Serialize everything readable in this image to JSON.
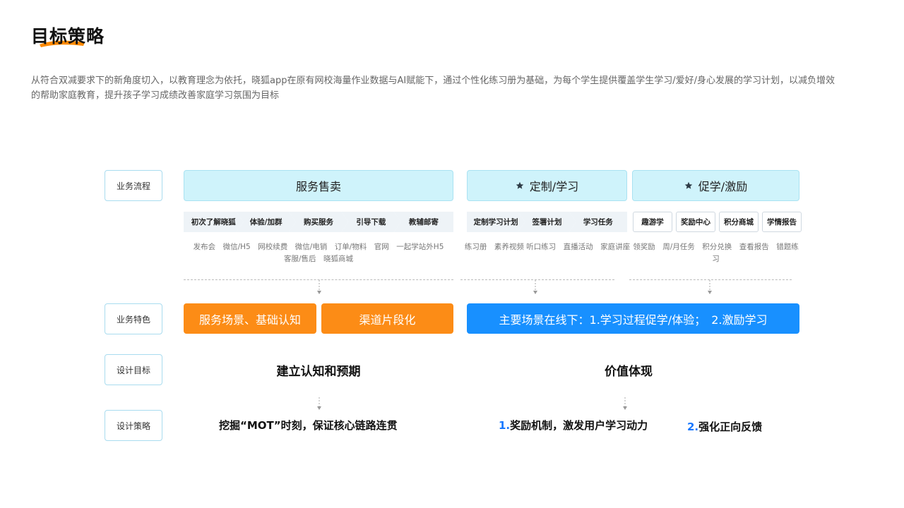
{
  "title": "目标策略",
  "intro": "从符合双减要求下的新角度切入，以教育理念为依托，晓狐app在原有网校海量作业数据与AI赋能下，通过个性化练习册为基础，为每个学生提供覆盖学生学习/爱好/身心发展的学习计划，以减负增效的帮助家庭教育，提升孩子学习成绩改善家庭学习氛围为目标",
  "rows": {
    "flow": "业务流程",
    "feature": "业务特色",
    "goal": "设计目标",
    "strategy": "设计策略"
  },
  "stages": [
    {
      "title": "服务售卖",
      "steps": [
        "初次了解晓狐",
        "体验/加群",
        "购买服务",
        "引导下载",
        "教辅邮寄"
      ],
      "channels_line1": "发布会　微信/H5　网校续费　微信/电销　订单/物料　官网　一起学站外H5",
      "channels_line2": "客服/售后　晓狐商城"
    },
    {
      "title": "定制/学习",
      "steps": [
        "定制学习计划",
        "签署计划",
        "学习任务"
      ],
      "channels_line1": "练习册　素养视频  听口练习　直播活动　家庭讲座"
    },
    {
      "title": "促学/激励",
      "steps": [
        "趣游学",
        "奖励中心",
        "积分商城",
        "学情报告"
      ],
      "channels_line1": "领奖励　周/月任务　积分兑换　查看报告　错题练习"
    }
  ],
  "features": {
    "orange1": "服务场景、基础认知",
    "orange2": "渠道片段化",
    "blue": "主要场景在线下：1.学习过程促学/体验；　2.激励学习"
  },
  "goals": {
    "left": "建立认知和预期",
    "right": "价值体现"
  },
  "strategies": {
    "left": "挖掘“MOT”时刻，保证核心链路连贯",
    "right1_num": "1.",
    "right1_text": "奖励机制，激发用户学习动力",
    "right2_num": "2.",
    "right2_text": "强化正向反馈"
  },
  "colors": {
    "stage_bg": "#cff3fb",
    "orange": "#fc8c16",
    "blue": "#1890ff",
    "title_stroke": "#ff8a00"
  }
}
